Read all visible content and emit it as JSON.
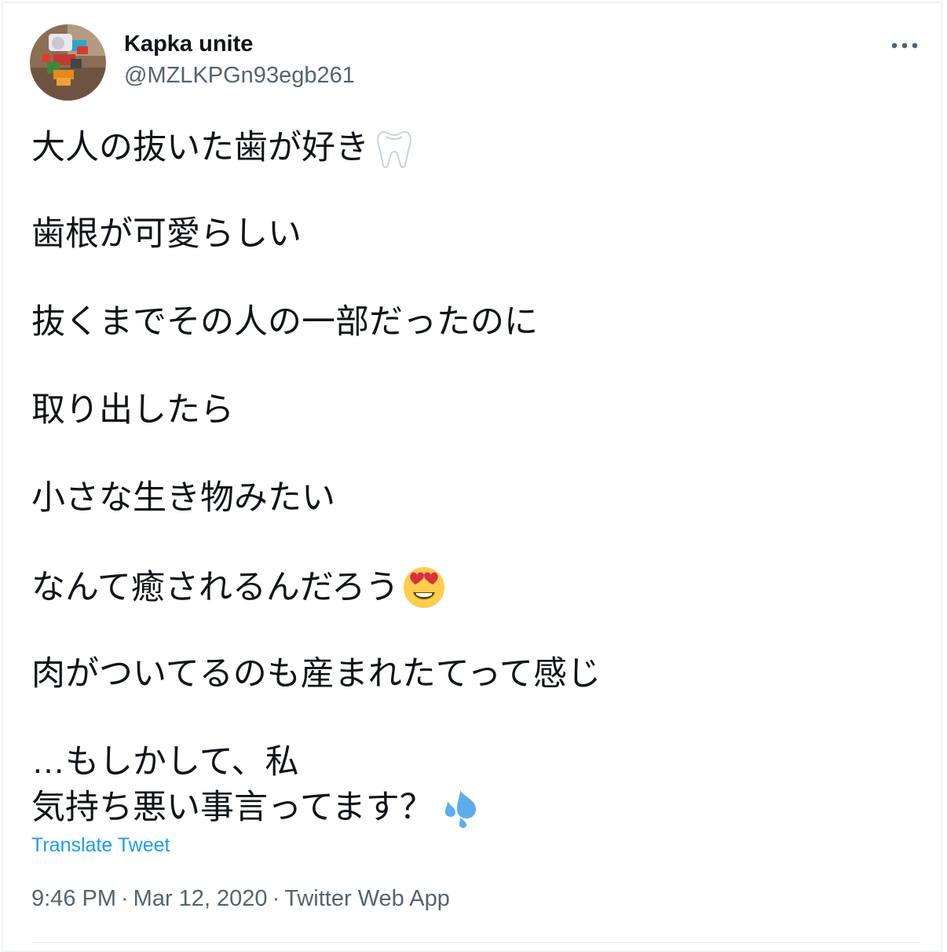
{
  "author": {
    "display_name": "Kapka unite",
    "handle": "@MZLKPGn93egb261"
  },
  "tweet": {
    "lines": [
      "大人の抜いた歯が好き",
      "歯根が可愛らしい",
      "抜くまでその人の一部だったのに",
      "取り出したら",
      "小さな生き物みたい",
      "なんて癒されるんだろう",
      "肉がついてるのも産まれたてって感じ",
      "…もしかして、私",
      "気持ち悪い事言ってます？"
    ],
    "emojis": {
      "line1": "tooth-emoji",
      "line6": "heart-eyes-emoji",
      "line9": "sweat-droplets-emoji"
    }
  },
  "translate_label": "Translate Tweet",
  "meta": {
    "time": "9:46 PM",
    "date": "Mar 12, 2020",
    "source": "Twitter Web App",
    "separator": "·"
  },
  "colors": {
    "text_primary": "#0f1419",
    "text_secondary": "#536471",
    "link": "#1d9bf0",
    "border": "#eff3f4"
  },
  "icons": {
    "more": "more-options-icon"
  }
}
